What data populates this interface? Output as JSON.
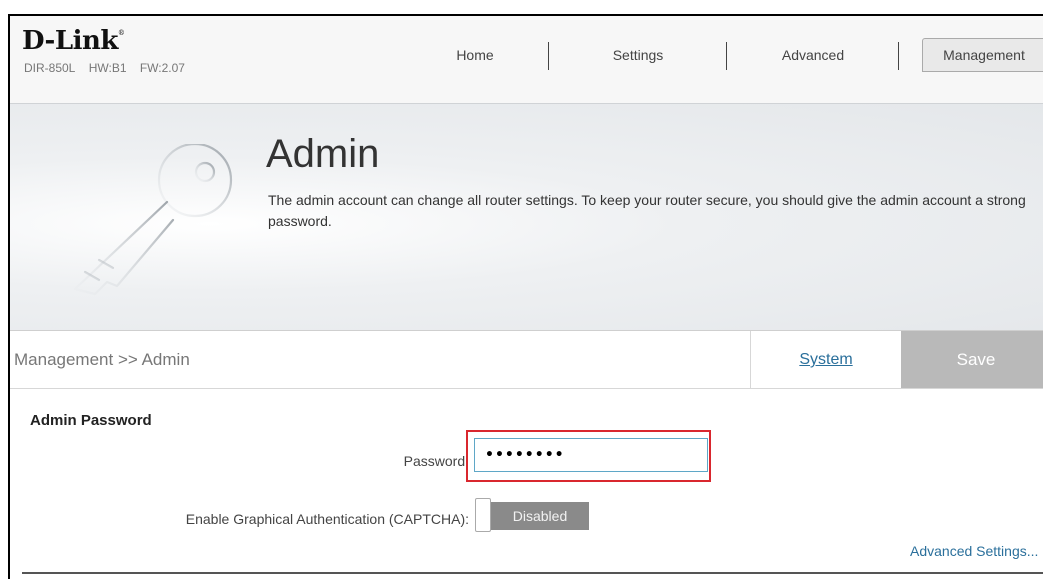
{
  "header": {
    "brand": "D-Link",
    "brand_mark": "®",
    "device": {
      "model": "DIR-850L",
      "hw": "HW:B1",
      "fw": "FW:2.07"
    }
  },
  "nav": {
    "items": [
      {
        "label": "Home",
        "active": false
      },
      {
        "label": "Settings",
        "active": false
      },
      {
        "label": "Advanced",
        "active": false
      },
      {
        "label": "Management",
        "active": true
      }
    ]
  },
  "banner": {
    "title": "Admin",
    "description": "The admin account can change all router settings. To keep your router secure, you should give the admin account a strong password.",
    "icon": "key-icon"
  },
  "crumb": {
    "path": "Management >> Admin",
    "system_link": "System",
    "save_label": "Save"
  },
  "admin_password": {
    "section_title": "Admin Password",
    "password_label": "Password:",
    "password_value": "••••••••",
    "captcha_label": "Enable Graphical Authentication (CAPTCHA):",
    "captcha_state": "Disabled"
  },
  "footer": {
    "advanced_settings": "Advanced Settings..."
  },
  "colors": {
    "link": "#2a6f9b",
    "highlight": "#d9272e",
    "toggle_off": "#8a8a8a",
    "save_bg": "#b9b9b9"
  }
}
